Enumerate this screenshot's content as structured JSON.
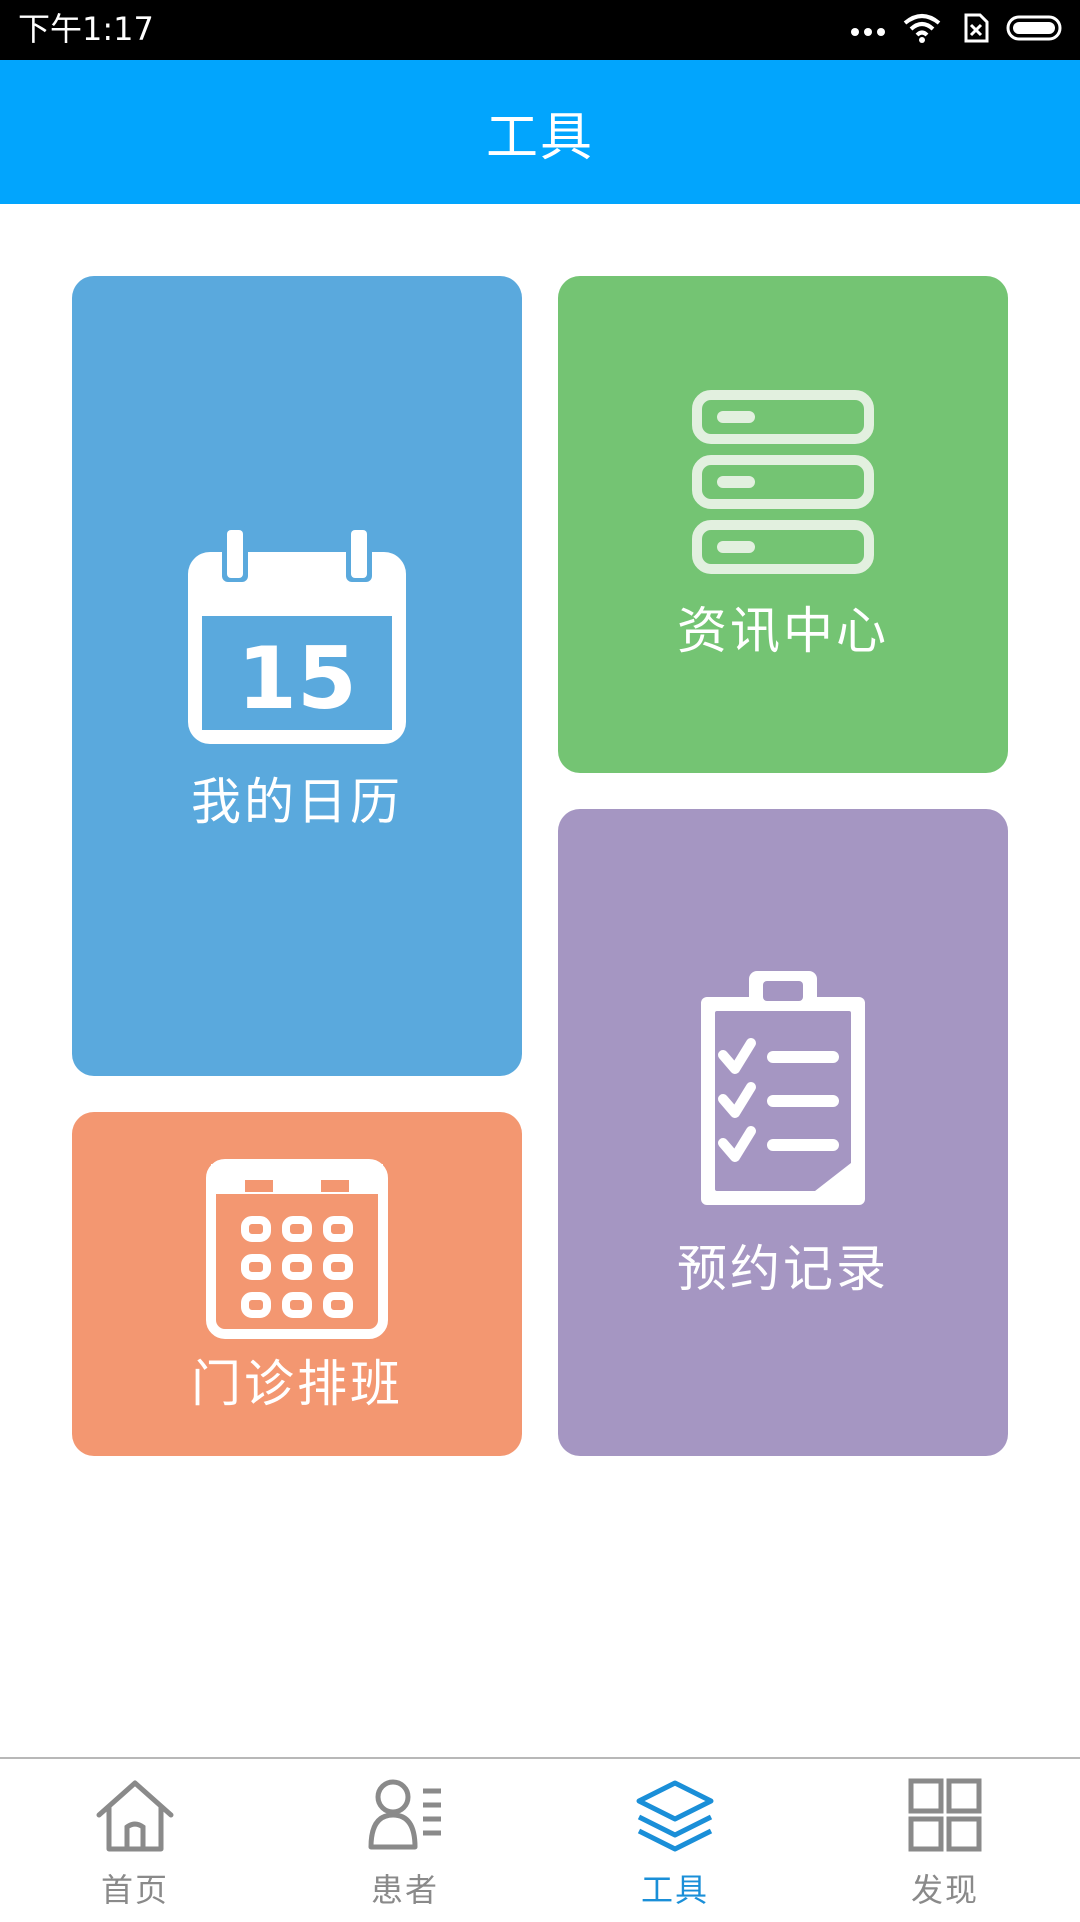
{
  "status_bar": {
    "time": "下午1:17",
    "icons": [
      "more-dots-icon",
      "wifi-icon",
      "no-sim-icon",
      "battery-icon"
    ]
  },
  "header": {
    "title": "工具"
  },
  "tiles": [
    {
      "label": "我的日历",
      "icon": "calendar-15-icon",
      "icon_text": "15",
      "color": "#5aa9dd"
    },
    {
      "label": "资讯中心",
      "icon": "server-list-icon",
      "color": "#74c473"
    },
    {
      "label": "预约记录",
      "icon": "clipboard-checklist-icon",
      "color": "#a596c2"
    },
    {
      "label": "门诊排班",
      "icon": "calendar-grid-icon",
      "color": "#f39771"
    }
  ],
  "tab_bar": {
    "items": [
      {
        "label": "首页",
        "icon": "home-icon",
        "active": false
      },
      {
        "label": "患者",
        "icon": "patients-icon",
        "active": false
      },
      {
        "label": "工具",
        "icon": "layers-icon",
        "active": true
      },
      {
        "label": "发现",
        "icon": "grid-icon",
        "active": false
      }
    ],
    "active_color": "#1a8fd8",
    "inactive_color": "#8a8a8a"
  }
}
